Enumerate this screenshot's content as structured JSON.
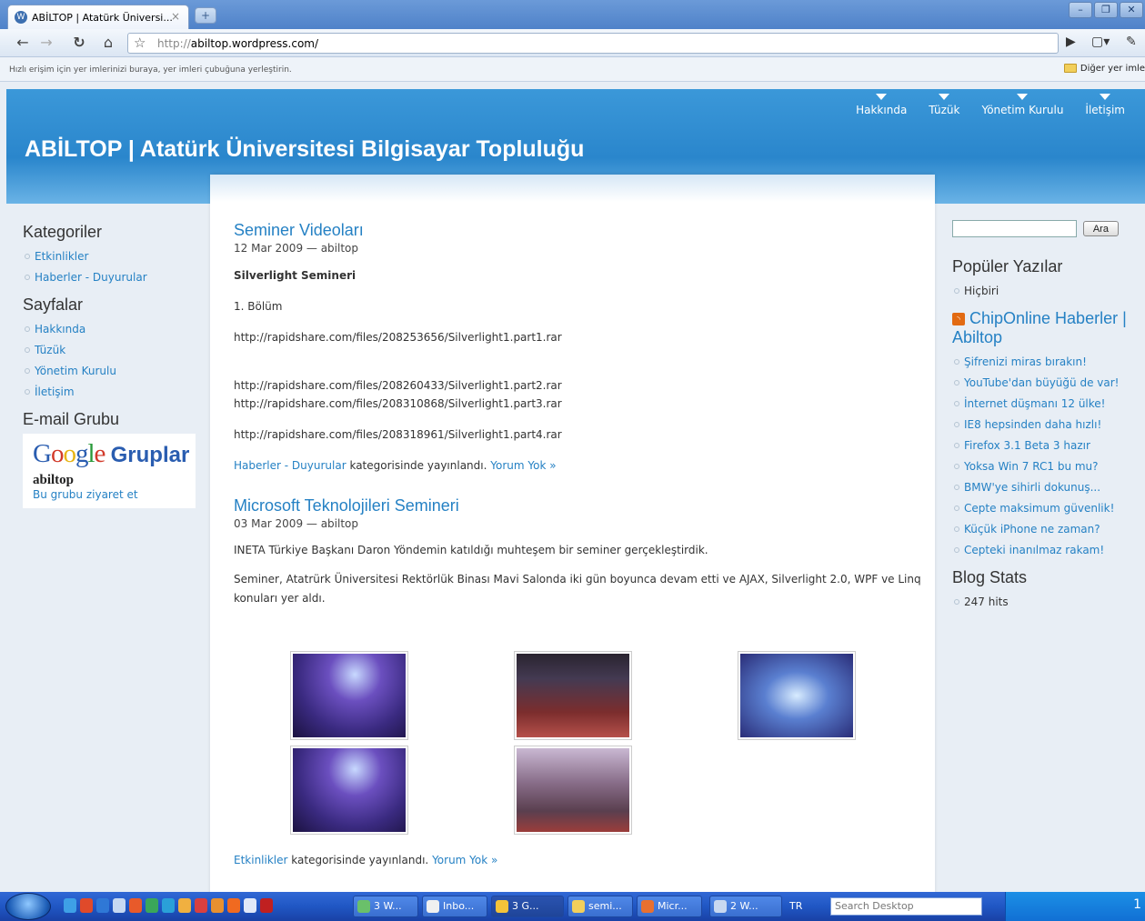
{
  "browser": {
    "tab_title": "ABİLTOP | Atatürk Üniversi...",
    "tab_close": "×",
    "new_tab": "+",
    "url_proto": "http://",
    "url_rest": "abiltop.wordpress.com/",
    "bookmark_hint": "Hızlı erişim için yer imlerinizi buraya, yer imleri çubuğuna yerleştirin.",
    "other_bookmarks": "Diğer yer imle"
  },
  "site": {
    "title": "ABİLTOP | Atatürk Üniversitesi Bilgisayar Topluluğu",
    "nav": [
      "Hakkında",
      "Tüzük",
      "Yönetim Kurulu",
      "İletişim"
    ]
  },
  "sidebar_left": {
    "categories_title": "Kategoriler",
    "categories": [
      "Etkinlikler",
      "Haberler - Duyurular"
    ],
    "pages_title": "Sayfalar",
    "pages": [
      "Hakkında",
      "Tüzük",
      "Yönetim Kurulu",
      "İletişim"
    ],
    "email_title": "E-mail Grubu",
    "google_group_name": "abiltop",
    "google_group_link": "Bu grubu ziyaret et",
    "google_logo_suffix": "Gruplar"
  },
  "sidebar_right": {
    "search_button": "Ara",
    "popular_title": "Popüler Yazılar",
    "popular_items": [
      "Hiçbiri"
    ],
    "feed_title": "ChipOnline Haberler | Abiltop",
    "feed_items": [
      "Şifrenizi miras bırakın!",
      "YouTube'dan büyüğü de var!",
      "İnternet düşmanı 12 ülke!",
      "IE8 hepsinden daha hızlı!",
      "Firefox 3.1 Beta 3 hazır",
      "Yoksa Win 7 RC1 bu mu?",
      "BMW'ye sihirli dokunuş...",
      "Cepte maksimum güvenlik!",
      "Küçük iPhone ne zaman?",
      "Cepteki inanılmaz rakam!"
    ],
    "stats_title": "Blog Stats",
    "stats_items": [
      "247 hits"
    ]
  },
  "posts": [
    {
      "title": "Seminer Videoları",
      "meta": "12 Mar 2009 — abiltop",
      "subtitle": "Silverlight Semineri",
      "part_label": "1. Bölüm",
      "links": [
        "http://rapidshare.com/files/208253656/Silverlight1.part1.rar",
        "http://rapidshare.com/files/208260433/Silverlight1.part2.rar",
        "http://rapidshare.com/files/208310868/Silverlight1.part3.rar",
        "http://rapidshare.com/files/208318961/Silverlight1.part4.rar"
      ],
      "category": "Haberler - Duyurular",
      "published_text": " kategorisinde yayınlandı. ",
      "comments": "Yorum Yok »"
    },
    {
      "title": "Microsoft Teknolojileri Semineri",
      "meta": "03 Mar 2009 — abiltop",
      "para1": "INETA Türkiye Başkanı Daron Yöndemin katıldığı muhteşem bir seminer gerçekleştirdik.",
      "para2": "Seminer, Atatrürk Üniversitesi Rektörlük Binası Mavi Salonda iki gün boyunca devam etti ve AJAX, Silverlight 2.0, WPF ve Linq konuları yer aldı.",
      "category": "Etkinlikler",
      "published_text": " kategorisinde yayınlandı. ",
      "comments": "Yorum Yok »"
    }
  ],
  "taskbar": {
    "buttons": [
      "3 W...",
      "Inbo...",
      "3 G...",
      "semi...",
      "Micr...",
      "2 W..."
    ],
    "lang": "TR",
    "search_placeholder": "Search Desktop",
    "clock": "1"
  }
}
